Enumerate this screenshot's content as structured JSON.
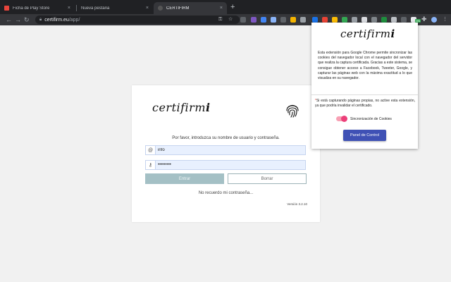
{
  "browser": {
    "tabs": [
      {
        "title": "Ficha de Play Store",
        "active": false
      },
      {
        "title": "Nueva pestaña",
        "active": false
      },
      {
        "title": "CERTIFIRM",
        "active": true
      }
    ],
    "tab_close_glyph": "×",
    "new_tab_glyph": "+",
    "omnibox": {
      "domain": "certifirm.eu",
      "path": "/app/"
    },
    "colors": {
      "tabstrip": "#202124",
      "toolbar": "#35363a",
      "omnibox": "#202124"
    }
  },
  "login": {
    "logo_text": "certifirm",
    "logo_mark": "i",
    "prompt": "Por favor, introduzca su nombre de usuario y contraseña.",
    "username_prefix": "@",
    "username_value": "info",
    "password_value": "•••••••••",
    "submit_label": "Entrar",
    "clear_label": "Borrar",
    "forgot_link": "No recuerdo mi contraseña...",
    "version": "Versión 3.2.10",
    "colors": {
      "submit_bg": "#a4c0c5",
      "field_bg": "#e8f0fe"
    }
  },
  "popup": {
    "logo_text": "certifirm",
    "logo_mark": "i",
    "description": "Esta extensión para Google Chrome permite sincronizar las cookies del navegador local con el navegador del servidor que realiza la captura certificada. Gracias a este sistema, se consigue obtener acceso a Facebook, Tweeter, Google, y capturar las páginas web con la máxima exactitud a lo que visualiza en su navegador.",
    "warning_star": "*",
    "warning": "Si está capturando páginas propias, no active esta extensión, ya que podría invalidar el certificado.",
    "toggle_label": "Sincronización de Cookies",
    "toggle_on": true,
    "control_button": "Panel de Control",
    "colors": {
      "toggle": "#ec407a",
      "button": "#3f51b5"
    }
  }
}
